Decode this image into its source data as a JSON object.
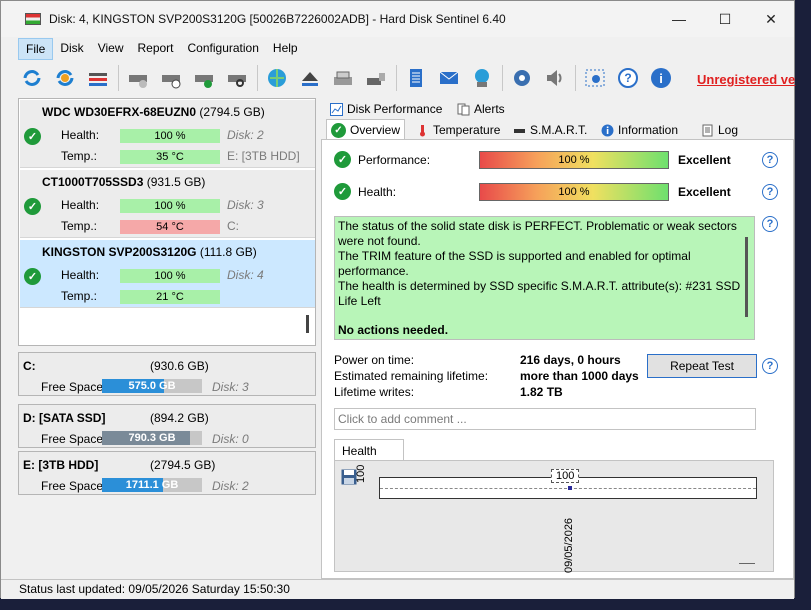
{
  "window": {
    "title": "Disk: 4, KINGSTON SVP200S3120G [50026B7226002ADB]  -  Hard Disk Sentinel 6.40",
    "minimize": "—",
    "maximize": "☐",
    "close": "✕"
  },
  "menu": {
    "items": [
      "File",
      "Disk",
      "View",
      "Report",
      "Configuration",
      "Help"
    ]
  },
  "toolbar": {
    "unregistered": "Unregistered ve"
  },
  "disks": [
    {
      "name": "WDC WD30EFRX-68EUZN0",
      "size": "(2794.5 GB)",
      "health_label": "Health:",
      "health": "100 %",
      "temp_label": "Temp.:",
      "temp": "35 °C",
      "disk_no": "Disk: 2",
      "volume": "E: [3TB HDD]"
    },
    {
      "name": "CT1000T705SSD3",
      "size": "(931.5 GB)",
      "health_label": "Health:",
      "health": "100 %",
      "temp_label": "Temp.:",
      "temp": "54 °C",
      "disk_no": "Disk: 3",
      "volume": "C:"
    },
    {
      "name": "KINGSTON SVP200S3120G",
      "size": "(111.8 GB)",
      "health_label": "Health:",
      "health": "100 %",
      "temp_label": "Temp.:",
      "temp": "21 °C",
      "disk_no": "Disk: 4",
      "volume": ""
    }
  ],
  "volumes": [
    {
      "name": "C:",
      "size": "(930.6 GB)",
      "free_label": "Free Space",
      "free": "575.0 GB",
      "free_fraction": 0.62,
      "disk": "Disk: 3"
    },
    {
      "name": "D: [SATA SSD]",
      "size": "(894.2 GB)",
      "free_label": "Free Space",
      "free": "790.3 GB",
      "free_fraction": 0.88,
      "disk": "Disk: 0"
    },
    {
      "name": "E: [3TB HDD]",
      "size": "(2794.5 GB)",
      "free_label": "Free Space",
      "free": "1711.1 GB",
      "free_fraction": 0.61,
      "disk": "Disk: 2"
    }
  ],
  "tabs": {
    "top": [
      "Disk Performance",
      "Alerts"
    ],
    "bottom": [
      "Overview",
      "Temperature",
      "S.M.A.R.T.",
      "Information",
      "Log"
    ]
  },
  "overview": {
    "performance_label": "Performance:",
    "performance_value": "100 %",
    "performance_rating": "Excellent",
    "health_label": "Health:",
    "health_value": "100 %",
    "health_rating": "Excellent",
    "status_lines": [
      "The status of the solid state disk is PERFECT. Problematic or weak sectors were not found.",
      "The TRIM feature of the SSD is supported and enabled for optimal performance.",
      "The health is determined by SSD specific S.M.A.R.T. attribute(s):  #231 SSD Life Left"
    ],
    "no_actions": "No actions needed.",
    "power_on_label": "Power on time:",
    "power_on_value": "216 days, 0 hours",
    "remaining_label": "Estimated remaining lifetime:",
    "remaining_value": "more than 1000 days",
    "writes_label": "Lifetime writes:",
    "writes_value": "1.82 TB",
    "repeat_test": "Repeat Test",
    "comment_placeholder": "Click to add comment ...",
    "health_tab": "Health (%)",
    "chart_value_label": "100",
    "chart_axis_label": "100",
    "chart_date": "09/05/2026"
  },
  "statusbar": {
    "text": "Status last updated: 09/05/2026 Saturday 15:50:30"
  }
}
